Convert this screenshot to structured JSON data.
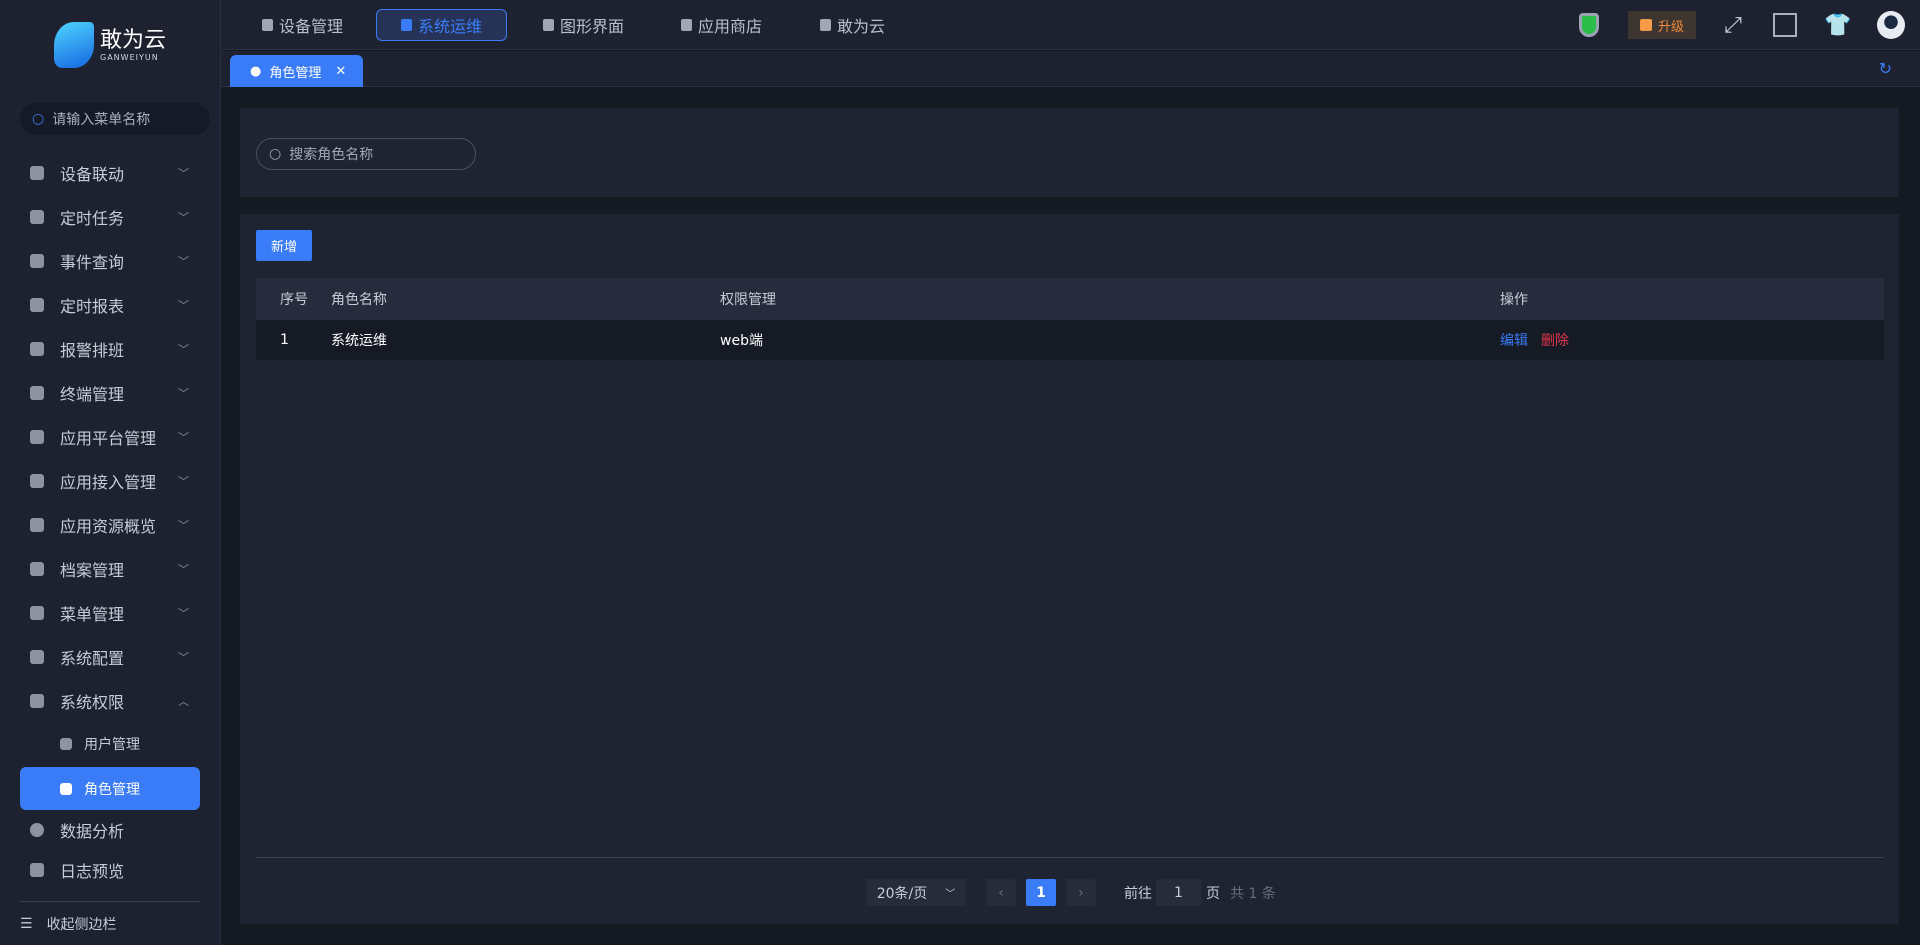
{
  "brand": {
    "name": "敢为云",
    "sub": "GANWEIYUN"
  },
  "sidebar": {
    "search_placeholder": "请输入菜单名称",
    "items": [
      {
        "label": "设备联动"
      },
      {
        "label": "定时任务"
      },
      {
        "label": "事件查询"
      },
      {
        "label": "定时报表"
      },
      {
        "label": "报警排班"
      },
      {
        "label": "终端管理"
      },
      {
        "label": "应用平台管理"
      },
      {
        "label": "应用接入管理"
      },
      {
        "label": "应用资源概览"
      },
      {
        "label": "档案管理"
      },
      {
        "label": "菜单管理"
      },
      {
        "label": "系统配置"
      },
      {
        "label": "系统权限"
      }
    ],
    "sub_items": [
      {
        "label": "用户管理"
      },
      {
        "label": "角色管理"
      }
    ],
    "bottom_items": [
      {
        "label": "数据分析"
      },
      {
        "label": "日志预览"
      }
    ],
    "collapse": "收起侧边栏"
  },
  "topnav": [
    {
      "label": "设备管理"
    },
    {
      "label": "系统运维"
    },
    {
      "label": "图形界面"
    },
    {
      "label": "应用商店"
    },
    {
      "label": "敢为云"
    }
  ],
  "upgrade": "升级",
  "tab": {
    "label": "角色管理",
    "close": "✕"
  },
  "search": {
    "placeholder": "搜索角色名称"
  },
  "new_button": "新增",
  "table": {
    "headers": [
      "序号",
      "角色名称",
      "权限管理",
      "操作"
    ],
    "rows": [
      {
        "index": "1",
        "name": "系统运维",
        "perm": "web端",
        "edit": "编辑",
        "delete": "删除"
      }
    ]
  },
  "pagination": {
    "page_size": "20条/页",
    "current": "1",
    "goto_label": "前往",
    "goto_value": "1",
    "page_unit": "页",
    "total": "共 1 条"
  }
}
